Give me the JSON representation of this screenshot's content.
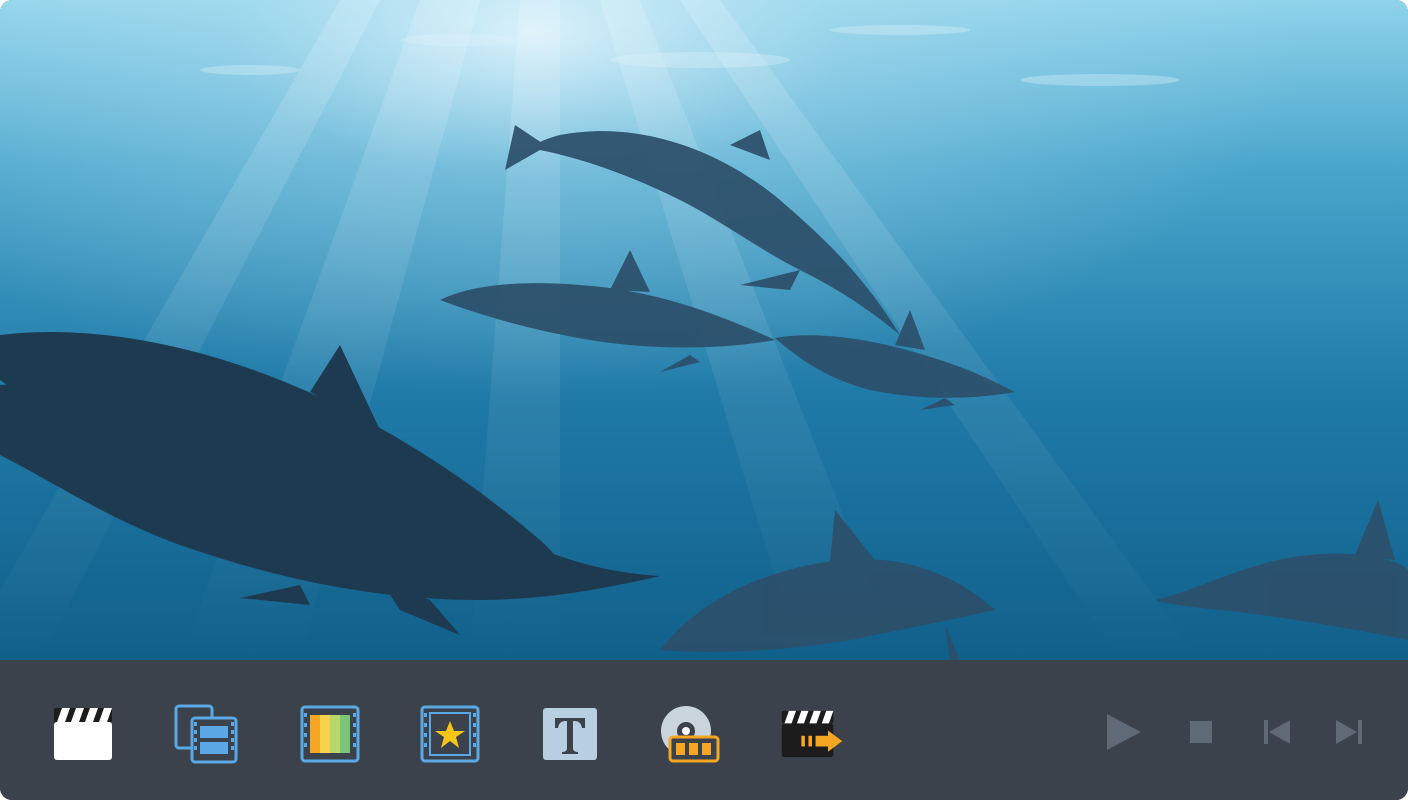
{
  "preview": {
    "scene": "underwater-dolphins",
    "icon": "video-preview"
  },
  "toolbar": {
    "tools": [
      {
        "icon": "clapperboard-icon",
        "color": "#ffffff"
      },
      {
        "icon": "film-clips-icon",
        "color": "#5aa9e6"
      },
      {
        "icon": "color-filter-icon",
        "color": "#5aa9e6"
      },
      {
        "icon": "film-star-icon",
        "color": "#5aa9e6"
      },
      {
        "icon": "text-title-icon",
        "color": "#b7cfe0"
      },
      {
        "icon": "disc-burn-icon",
        "color": "#f5a623"
      },
      {
        "icon": "export-video-icon",
        "color": "#f5a623"
      }
    ],
    "player": [
      {
        "icon": "play-icon"
      },
      {
        "icon": "stop-icon"
      },
      {
        "icon": "skip-back-icon"
      },
      {
        "icon": "skip-forward-icon"
      }
    ],
    "control_color": "#5f6a76"
  }
}
